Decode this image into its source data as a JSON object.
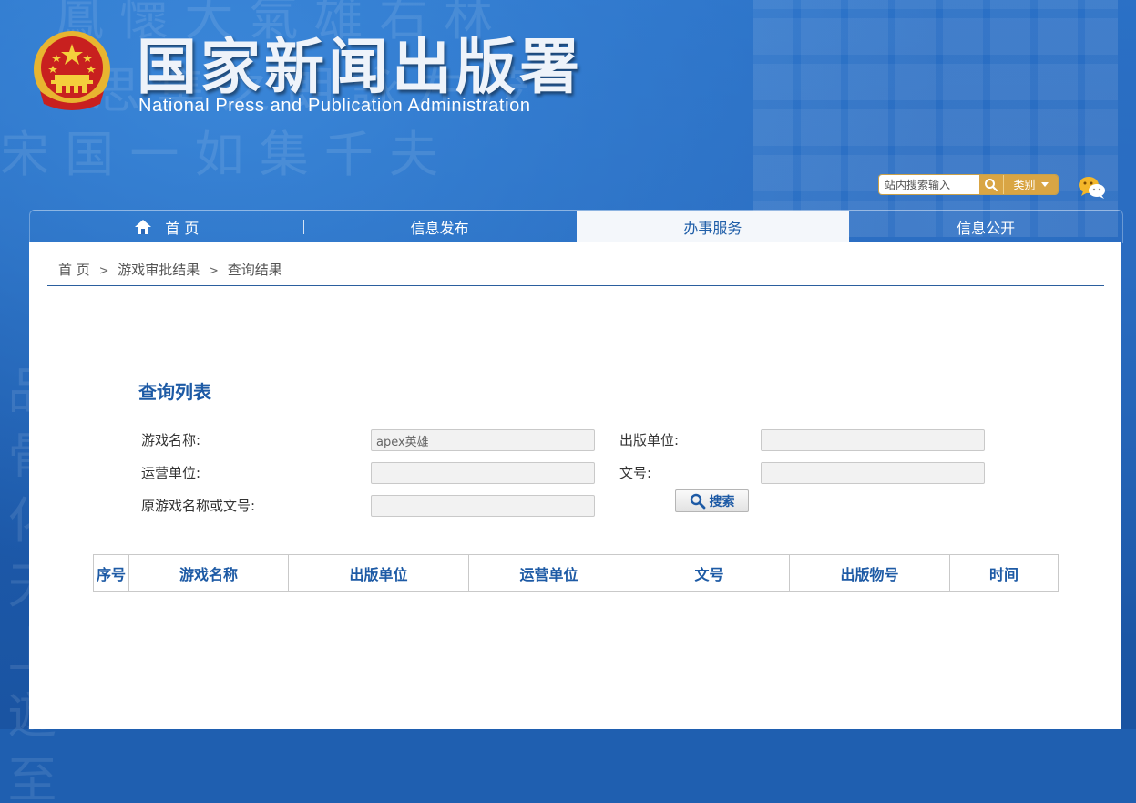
{
  "header": {
    "title": "国家新闻出版署",
    "subtitle": "National  Press and Publication Administration"
  },
  "background_calligraphy": [
    "宋 国 一 如 集 千 夫",
    "思 集 之 朗 詠 左 茂",
    "鳳 懷 大 氣 雄 右 林",
    "品 骨 化 天 上 遊 至"
  ],
  "search": {
    "placeholder": "站内搜索输入",
    "category_label": "类别"
  },
  "nav": {
    "items": [
      {
        "label": "首 页"
      },
      {
        "label": "信息发布"
      },
      {
        "label": "办事服务"
      },
      {
        "label": "信息公开"
      }
    ]
  },
  "breadcrumb": {
    "home": "首 页",
    "level1": "游戏审批结果",
    "current": "查询结果",
    "separator": ">"
  },
  "query": {
    "title": "查询列表",
    "fields": {
      "game_name_label": "游戏名称:",
      "game_name_value": "apex英雄",
      "publisher_label": "出版单位:",
      "publisher_value": "",
      "operator_label": "运营单位:",
      "operator_value": "",
      "doc_no_label": "文号:",
      "doc_no_value": "",
      "original_label": "原游戏名称或文号:",
      "original_value": ""
    },
    "search_button": "搜索"
  },
  "table": {
    "headers": [
      "序号",
      "游戏名称",
      "出版单位",
      "运营单位",
      "文号",
      "出版物号",
      "时间"
    ],
    "rows": []
  },
  "colors": {
    "banner_blue": "#1f5fb0",
    "title_blue": "#1d5aa5",
    "gold": "#d9a544"
  }
}
